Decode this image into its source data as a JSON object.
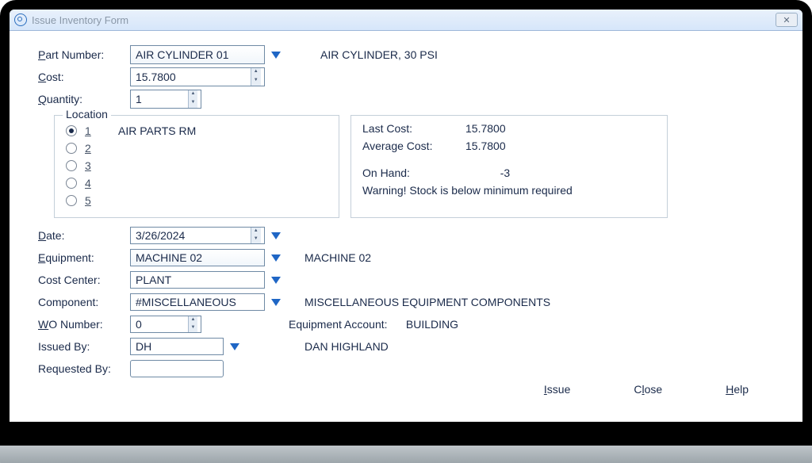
{
  "window": {
    "title": "Issue Inventory Form"
  },
  "labels": {
    "part_number": "Part Number:",
    "cost": "Cost:",
    "quantity": "Quantity:",
    "location": "Location",
    "date": "Date:",
    "equipment": "Equipment:",
    "cost_center": "Cost Center:",
    "component": "Component:",
    "wo_number": "WO Number:",
    "issued_by": "Issued By:",
    "requested_by": "Requested By:",
    "last_cost": "Last Cost:",
    "avg_cost": "Average Cost:",
    "on_hand": "On Hand:",
    "equipment_account": "Equipment Account:"
  },
  "values": {
    "part_number": "AIR CYLINDER 01",
    "part_desc": "AIR CYLINDER, 30 PSI",
    "cost": "15.7800",
    "quantity": "1",
    "date": "3/26/2024",
    "equipment": "MACHINE 02",
    "equipment_desc": "MACHINE 02",
    "cost_center": "PLANT",
    "component": "#MISCELLANEOUS",
    "component_desc": "MISCELLANEOUS EQUIPMENT COMPONENTS",
    "wo_number": "0",
    "issued_by": "DH",
    "issued_by_desc": "DAN HIGHLAND",
    "requested_by": "",
    "equipment_account": "BUILDING"
  },
  "locations": [
    {
      "n": "1",
      "name": "AIR PARTS RM",
      "checked": true
    },
    {
      "n": "2",
      "name": "",
      "checked": false
    },
    {
      "n": "3",
      "name": "",
      "checked": false
    },
    {
      "n": "4",
      "name": "",
      "checked": false
    },
    {
      "n": "5",
      "name": "",
      "checked": false
    }
  ],
  "stock": {
    "last_cost": "15.7800",
    "avg_cost": "15.7800",
    "on_hand": "-3",
    "warning": "Warning! Stock is below minimum required"
  },
  "buttons": {
    "issue": "Issue",
    "close": "Close",
    "help": "Help"
  }
}
